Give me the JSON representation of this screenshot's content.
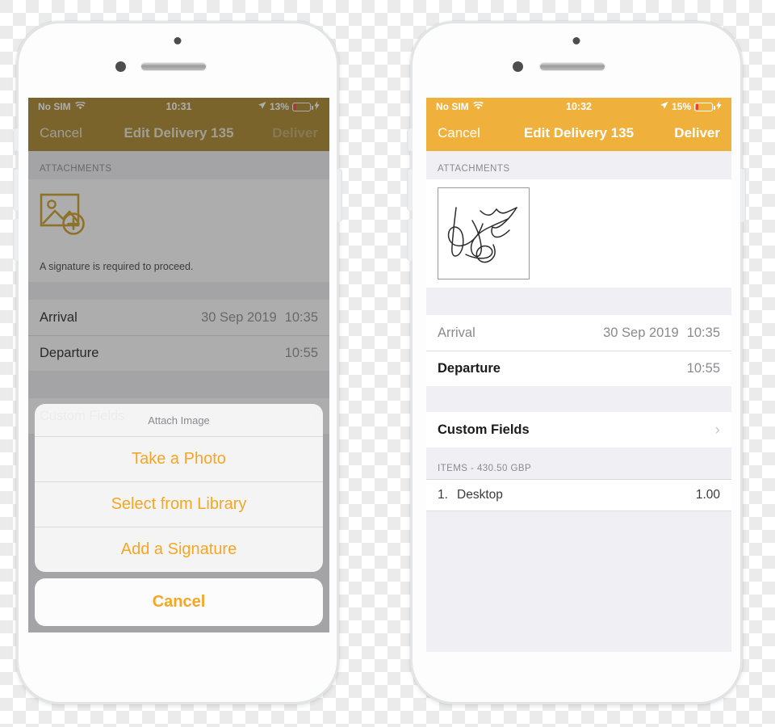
{
  "phones": {
    "left": {
      "status_bar": {
        "carrier": "No SIM",
        "wifi_icon": "wifi-icon",
        "time": "10:31",
        "location_icon": "location-arrow-icon",
        "battery_percent": "13%",
        "battery_fill": 13,
        "charging_icon": "lightning-bolt-icon"
      },
      "nav": {
        "cancel_label": "Cancel",
        "title": "Edit Delivery 135",
        "deliver_label": "Deliver"
      },
      "attachments": {
        "header": "ATTACHMENTS",
        "add_image_icon": "add-image-icon",
        "helper_text": "A signature is required to proceed."
      },
      "rows": [
        {
          "label": "Arrival",
          "date": "30 Sep 2019",
          "time": "10:35"
        },
        {
          "label": "Departure",
          "date": "",
          "time": "10:55"
        }
      ],
      "custom_fields": {
        "label": "Custom Fields",
        "chevron_icon": "chevron-right-icon"
      },
      "action_sheet": {
        "title": "Attach Image",
        "options": [
          "Take a Photo",
          "Select from Library",
          "Add a Signature"
        ],
        "cancel_label": "Cancel"
      }
    },
    "right": {
      "status_bar": {
        "carrier": "No SIM",
        "wifi_icon": "wifi-icon",
        "time": "10:32",
        "location_icon": "location-arrow-icon",
        "battery_percent": "15%",
        "battery_fill": 15,
        "charging_icon": "lightning-bolt-icon"
      },
      "nav": {
        "cancel_label": "Cancel",
        "title": "Edit Delivery 135",
        "deliver_label": "Deliver"
      },
      "attachments": {
        "header": "ATTACHMENTS",
        "signature_icon": "signature-thumbnail"
      },
      "rows": [
        {
          "label": "Arrival",
          "date": "30 Sep 2019",
          "time": "10:35"
        },
        {
          "label": "Departure",
          "date": "",
          "time": "10:55"
        }
      ],
      "custom_fields": {
        "label": "Custom Fields",
        "chevron_icon": "chevron-right-icon"
      },
      "items": {
        "header": "ITEMS - 430.50 GBP",
        "rows": [
          {
            "index": "1.",
            "name": "Desktop",
            "qty": "1.00"
          }
        ]
      }
    }
  },
  "colors": {
    "accent_orange": "#F0AE3C",
    "accent_orange_dimmed": "#A07C22",
    "sheet_orange": "#F5A623",
    "battery_red": "#F23B30",
    "group_background": "#EFEFF4"
  }
}
